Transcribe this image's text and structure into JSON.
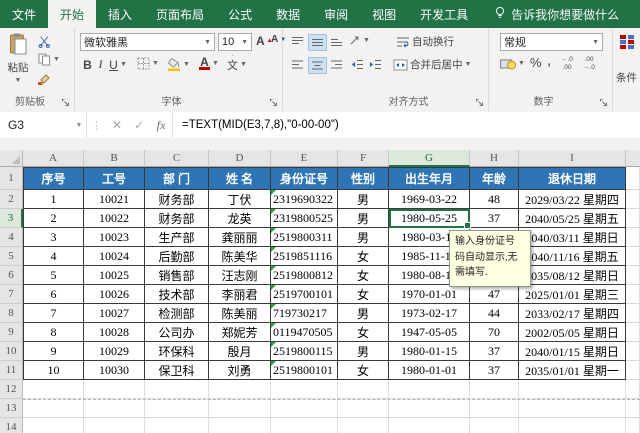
{
  "menu": {
    "tabs": [
      "文件",
      "开始",
      "插入",
      "页面布局",
      "公式",
      "数据",
      "审阅",
      "视图",
      "开发工具"
    ],
    "active_tab": "开始",
    "tell_me": "告诉我你想要做什么"
  },
  "ribbon": {
    "clipboard": {
      "group_label": "剪贴板",
      "paste_label": "粘贴"
    },
    "font": {
      "group_label": "字体",
      "font_name": "微软雅黑",
      "font_size": "10",
      "bold": "B",
      "italic": "I",
      "underline": "U",
      "grow": "A",
      "shrink": "A",
      "font_color": "A",
      "phonetic": "文"
    },
    "alignment": {
      "group_label": "对齐方式",
      "wrap_text": "自动换行",
      "merge_center": "合并后居中"
    },
    "number": {
      "group_label": "数字",
      "format_value": "常规",
      "percent": "%",
      "comma": ","
    },
    "conditional": {
      "label": "条件"
    }
  },
  "formula_bar": {
    "cell_ref": "G3",
    "fx_label": "fx",
    "formula": "=TEXT(MID(E3,7,8),\"0-00-00\")"
  },
  "grid": {
    "col_letters": [
      "A",
      "B",
      "C",
      "D",
      "E",
      "F",
      "G",
      "H",
      "I"
    ],
    "header_row": [
      "序号",
      "工号",
      "部 门",
      "姓 名",
      "身份证号",
      "性别",
      "出生年月",
      "年龄",
      "退休日期"
    ],
    "rows": [
      [
        "1",
        "10021",
        "财务部",
        "丁伏",
        "2319690322",
        "男",
        "1969-03-22",
        "48",
        "2029/03/22 星期四"
      ],
      [
        "2",
        "10022",
        "财务部",
        "龙英",
        "2319800525",
        "男",
        "1980-05-25",
        "37",
        "2040/05/25 星期五"
      ],
      [
        "3",
        "10023",
        "生产部",
        "龚丽丽",
        "2519800311",
        "男",
        "1980-03-11",
        "",
        "2040/03/11 星期日"
      ],
      [
        "4",
        "10024",
        "后勤部",
        "陈美华",
        "2519851116",
        "女",
        "1985-11-16",
        "",
        "2040/11/16 星期五"
      ],
      [
        "5",
        "10025",
        "销售部",
        "汪志刚",
        "2519800812",
        "女",
        "1980-08-12",
        "",
        "2035/08/12 星期日"
      ],
      [
        "6",
        "10026",
        "技术部",
        "李丽君",
        "2519700101",
        "女",
        "1970-01-01",
        "47",
        "2025/01/01 星期三"
      ],
      [
        "7",
        "10027",
        "检测部",
        "陈美丽",
        "719730217",
        "男",
        "1973-02-17",
        "44",
        "2033/02/17 星期四"
      ],
      [
        "8",
        "10028",
        "公司办",
        "郑妮芳",
        "0119470505",
        "女",
        "1947-05-05",
        "70",
        "2002/05/05 星期日"
      ],
      [
        "9",
        "10029",
        "环保科",
        "殷月",
        "2519800115",
        "男",
        "1980-01-15",
        "37",
        "2040/01/15 星期日"
      ],
      [
        "10",
        "10030",
        "保卫科",
        "刘勇",
        "2519800101",
        "女",
        "1980-01-01",
        "37",
        "2035/01/01 星期一"
      ]
    ]
  },
  "tooltip": {
    "lines": [
      "输入身份证号",
      "码自动显示,无",
      "需填写."
    ]
  },
  "colors": {
    "excel_green": "#217346",
    "header_blue": "#2E75B6",
    "tooltip_bg": "#FFFFE1",
    "error_triangle_green": "#2F9E44"
  }
}
